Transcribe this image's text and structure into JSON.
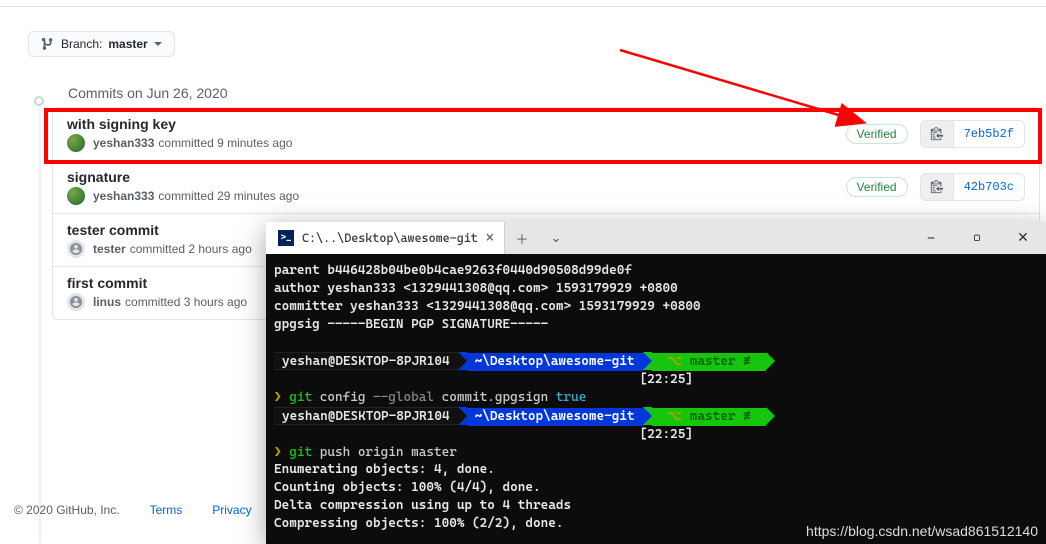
{
  "branch": {
    "label": "Branch:",
    "name": "master"
  },
  "group_title": "Commits on Jun 26, 2020",
  "commits": [
    {
      "title": "with signing key",
      "author": "yeshan333",
      "meta_suffix": "committed 9 minutes ago",
      "verified": "Verified",
      "hash": "7eb5b2f",
      "avatar": "y"
    },
    {
      "title": "signature",
      "author": "yeshan333",
      "meta_suffix": "committed 29 minutes ago",
      "verified": "Verified",
      "hash": "42b703c",
      "avatar": "y"
    },
    {
      "title": "tester commit",
      "author": "tester",
      "meta_suffix": "committed 2 hours ago",
      "verified": "",
      "hash": "",
      "avatar": "g"
    },
    {
      "title": "first commit",
      "author": "linus",
      "meta_suffix": "committed 3 hours ago",
      "verified": "",
      "hash": "",
      "avatar": "g"
    }
  ],
  "terminal": {
    "tab_title": "C:\\..\\Desktop\\awesome-git",
    "prompt_user": "yeshan@DESKTOP-8PJR104",
    "prompt_path": "~\\Desktop\\awesome-git",
    "prompt_branch": "master ≢",
    "prompt_time": "[22:25]",
    "lines": {
      "l0": "parent b446428b04be0b4cae9263f0440d90508d99de0f",
      "l1": "author yeshan333 <1329441308@qq.com> 1593179929 +0800",
      "l2": "committer yeshan333 <1329441308@qq.com> 1593179929 +0800",
      "l3": "gpgsig -----BEGIN PGP SIGNATURE-----",
      "cmd1_full": "git config --global commit.gpgsign true",
      "cmd1_p1": "git",
      "cmd1_p2": " config ",
      "cmd1_p3": "--global",
      "cmd1_p4": " commit.gpgsign ",
      "cmd1_p5": "true",
      "cmd2_p1": "git",
      "cmd2_p2": " push origin master",
      "out1": "Enumerating objects: 4, done.",
      "out2": "Counting objects: 100% (4/4), done.",
      "out3": "Delta compression using up to 4 threads",
      "out4": "Compressing objects: 100% (2/2), done."
    }
  },
  "footer": {
    "copyright": "© 2020 GitHub, Inc.",
    "terms": "Terms",
    "privacy": "Privacy"
  },
  "watermark": "https://blog.csdn.net/wsad861512140"
}
